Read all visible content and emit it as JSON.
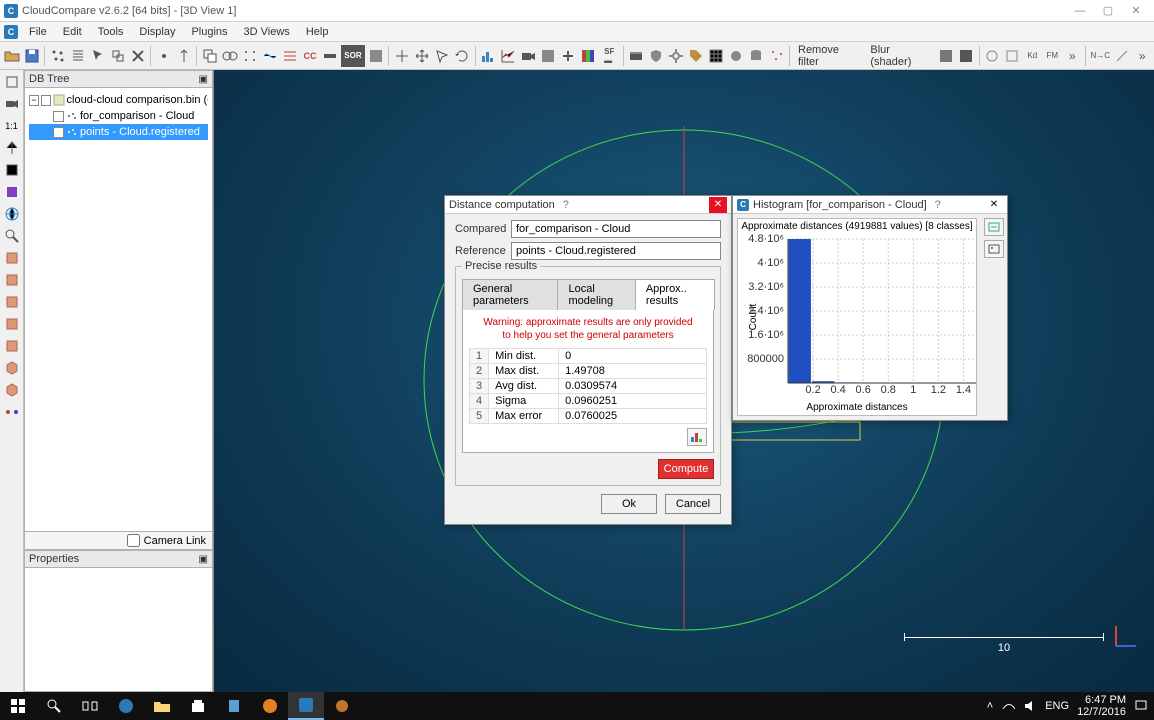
{
  "window": {
    "title": "CloudCompare v2.6.2 [64 bits] - [3D View 1]"
  },
  "menu": {
    "items": [
      "File",
      "Edit",
      "Tools",
      "Display",
      "Plugins",
      "3D Views",
      "Help"
    ]
  },
  "toolbar_right_labels": {
    "remove_filter": "Remove filter",
    "blur_shader": "Blur (shader)"
  },
  "dbtree": {
    "title": "DB Tree",
    "root": "cloud-cloud comparison.bin (C:/...",
    "child1": "for_comparison - Cloud",
    "child2": "points - Cloud.registered",
    "camera_link": "Camera Link"
  },
  "properties": {
    "title": "Properties"
  },
  "viewport": {
    "scale_label": "10"
  },
  "dist_dialog": {
    "title": "Distance computation",
    "compared_label": "Compared",
    "compared_value": "for_comparison - Cloud",
    "reference_label": "Reference",
    "reference_value": "points - Cloud.registered",
    "precise_results": "Precise results",
    "tabs": {
      "general": "General parameters",
      "local": "Local modeling",
      "approx": "Approx.. results"
    },
    "warning1": "Warning: approximate results are only provided",
    "warning2": "to help you set the general parameters",
    "stats": [
      {
        "i": "1",
        "label": "Min dist.",
        "value": "0"
      },
      {
        "i": "2",
        "label": "Max dist.",
        "value": "1.49708"
      },
      {
        "i": "3",
        "label": "Avg dist.",
        "value": "0.0309574"
      },
      {
        "i": "4",
        "label": "Sigma",
        "value": "0.0960251"
      },
      {
        "i": "5",
        "label": "Max error",
        "value": "0.0760025"
      }
    ],
    "compute": "Compute",
    "ok": "Ok",
    "cancel": "Cancel"
  },
  "hist_dialog": {
    "title": "Histogram [for_comparison - Cloud]",
    "chart_title": "Approximate distances (4919881 values) [8 classes]",
    "xlabel": "Approximate distances",
    "ylabel": "Count"
  },
  "chart_data": {
    "type": "bar",
    "title": "Approximate distances (4919881 values) [8 classes]",
    "xlabel": "Approximate distances",
    "ylabel": "Count",
    "x_ticks": [
      0.2,
      0.4,
      0.6,
      0.8,
      1,
      1.2,
      1.4
    ],
    "y_ticks": [
      "800000",
      "1.6·10⁶",
      "2.4·10⁶",
      "3.2·10⁶",
      "4·10⁶",
      "4.8·10⁶"
    ],
    "ylim": [
      0,
      4800000
    ],
    "xlim": [
      0,
      1.5
    ],
    "categories": [
      0.094,
      0.281,
      0.468,
      0.655,
      0.842,
      1.029,
      1.216,
      1.403
    ],
    "values": [
      4800000,
      60000,
      20000,
      15000,
      10000,
      8000,
      5000,
      2000
    ]
  },
  "taskbar": {
    "lang": "ENG",
    "time": "6:47 PM",
    "date": "12/7/2016"
  }
}
